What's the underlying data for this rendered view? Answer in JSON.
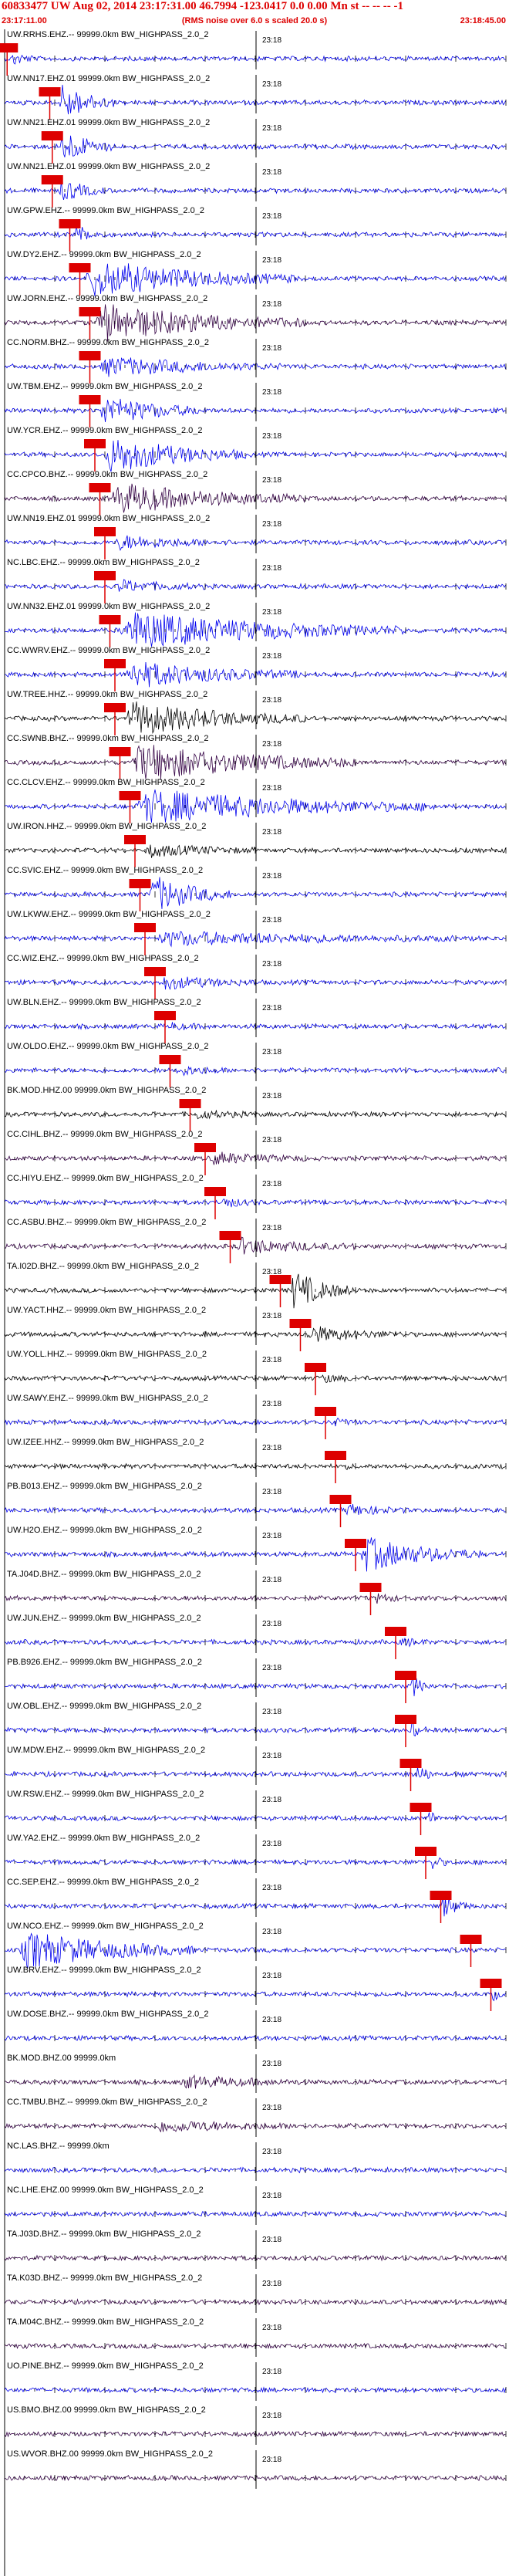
{
  "header": {
    "title": "60833477 UW Aug 02, 2014 23:17:31.00   46.7994 -123.0417  0.0 0.00 Mn st -- -- --  -1",
    "start_time": "23:17:11.00",
    "rms_note": "(RMS noise over 6.0 s scaled 20.0 s)",
    "end_time": "23:18:45.00"
  },
  "tick_label": "23:18",
  "colors": {
    "blue": "#0000ee",
    "purple": "#330044",
    "black": "#000000",
    "red": "#dd0000",
    "grid": "#777777"
  },
  "traces": [
    {
      "label": "UW.RRHS.EHZ.-- 99999.0km BW_HIGHPASS_2.0_2",
      "color": "blue",
      "pick": 0.005,
      "burst": [
        0.015,
        0.06
      ],
      "amp": 0.35
    },
    {
      "label": "UW.NN17.EHZ.01 99999.0km BW_HIGHPASS_2.0_2",
      "color": "blue",
      "pick": 0.09,
      "burst": [
        0.11,
        0.22
      ],
      "amp": 1.0
    },
    {
      "label": "UW.NN21.EHZ.01 99999.0km BW_HIGHPASS_2.0_2",
      "color": "blue",
      "pick": 0.095,
      "burst": [
        0.11,
        0.22
      ],
      "amp": 0.9
    },
    {
      "label": "UW.NN21.EHZ.01 99999.0km BW_HIGHPASS_2.0_2",
      "color": "blue",
      "pick": 0.095,
      "burst": [
        0.11,
        0.2
      ],
      "amp": 0.6
    },
    {
      "label": "UW.GPW.EHZ.-- 99999.0km BW_HIGHPASS_2.0_2",
      "color": "blue",
      "pick": 0.13,
      "burst": [
        0.14,
        0.2
      ],
      "amp": 0.5
    },
    {
      "label": "UW.DY2.EHZ.-- 99999.0km BW_HIGHPASS_2.0_2",
      "color": "blue",
      "pick": 0.15,
      "burst": [
        0.16,
        0.58
      ],
      "amp": 1.0
    },
    {
      "label": "UW.JORN.EHZ.-- 99999.0km BW_HIGHPASS_2.0_2",
      "color": "purple",
      "pick": 0.17,
      "burst": [
        0.18,
        0.6
      ],
      "amp": 1.0
    },
    {
      "label": "CC.NORM.BHZ.-- 99999.0km BW_HIGHPASS_2.0_2",
      "color": "blue",
      "pick": 0.17,
      "burst": [
        0.19,
        0.55
      ],
      "amp": 0.5
    },
    {
      "label": "UW.TBM.EHZ.-- 99999.0km BW_HIGHPASS_2.0_2",
      "color": "blue",
      "pick": 0.17,
      "burst": [
        0.19,
        0.4
      ],
      "amp": 0.8
    },
    {
      "label": "UW.YCR.EHZ.-- 99999.0km BW_HIGHPASS_2.0_2",
      "color": "blue",
      "pick": 0.18,
      "burst": [
        0.2,
        0.48
      ],
      "amp": 1.0
    },
    {
      "label": "CC.CPCO.BHZ.-- 99999.0km BW_HIGHPASS_2.0_2",
      "color": "purple",
      "pick": 0.19,
      "burst": [
        0.21,
        0.6
      ],
      "amp": 0.8
    },
    {
      "label": "UW.NN19.EHZ.01 99999.0km BW_HIGHPASS_2.0_2",
      "color": "blue",
      "pick": 0.2,
      "burst": [
        0.22,
        0.45
      ],
      "amp": 0.35
    },
    {
      "label": "NC.LBC.EHZ.-- 99999.0km BW_HIGHPASS_2.0_2",
      "color": "blue",
      "pick": 0.2,
      "burst": [
        0.22,
        0.4
      ],
      "amp": 0.3
    },
    {
      "label": "UW.NN32.EHZ.01 99999.0km BW_HIGHPASS_2.0_2",
      "color": "blue",
      "pick": 0.21,
      "burst": [
        0.23,
        0.8
      ],
      "amp": 1.0
    },
    {
      "label": "CC.WWRV.EHZ.-- 99999.0km BW_HIGHPASS_2.0_2",
      "color": "blue",
      "pick": 0.22,
      "burst": [
        0.24,
        0.6
      ],
      "amp": 0.7
    },
    {
      "label": "UW.TREE.HHZ.-- 99999.0km BW_HIGHPASS_2.0_2",
      "color": "black",
      "pick": 0.22,
      "burst": [
        0.24,
        0.6
      ],
      "amp": 0.9
    },
    {
      "label": "CC.SWNB.BHZ.-- 99999.0km BW_HIGHPASS_2.0_2",
      "color": "purple",
      "pick": 0.23,
      "burst": [
        0.25,
        0.7
      ],
      "amp": 1.0
    },
    {
      "label": "CC.CLCV.EHZ.-- 99999.0km BW_HIGHPASS_2.0_2",
      "color": "blue",
      "pick": 0.25,
      "burst": [
        0.26,
        0.86
      ],
      "amp": 0.9
    },
    {
      "label": "UW.IRON.HHZ.-- 99999.0km BW_HIGHPASS_2.0_2",
      "color": "black",
      "pick": 0.26,
      "burst": [
        0.28,
        0.5
      ],
      "amp": 0.3
    },
    {
      "label": "CC.SVIC.EHZ.-- 99999.0km BW_HIGHPASS_2.0_2",
      "color": "blue",
      "pick": 0.27,
      "burst": [
        0.29,
        0.45
      ],
      "amp": 1.0
    },
    {
      "label": "UW.LKWW.EHZ.-- 99999.0km BW_HIGHPASS_2.0_2",
      "color": "blue",
      "pick": 0.28,
      "burst": [
        0.3,
        0.9
      ],
      "amp": 0.35
    },
    {
      "label": "CC.WIZ.EHZ.-- 99999.0km BW_HIGHPASS_2.0_2",
      "color": "blue",
      "pick": 0.3,
      "burst": [
        0.31,
        0.5
      ],
      "amp": 0.35
    },
    {
      "label": "UW.BLN.EHZ.-- 99999.0km BW_HIGHPASS_2.0_2",
      "color": "blue",
      "pick": 0.32,
      "burst": [
        0.33,
        0.4
      ],
      "amp": 0.15
    },
    {
      "label": "UW.OLDO.EHZ.-- 99999.0km BW_HIGHPASS_2.0_2",
      "color": "blue",
      "pick": 0.33,
      "burst": [
        0.34,
        0.45
      ],
      "amp": 0.25
    },
    {
      "label": "BK.MOD.HHZ.00 99999.0km BW_HIGHPASS_2.0_2",
      "color": "black",
      "pick": 0.37,
      "burst": [
        0.38,
        0.5
      ],
      "amp": 0.2
    },
    {
      "label": "CC.CIHL.BHZ.-- 99999.0km BW_HIGHPASS_2.0_2",
      "color": "purple",
      "pick": 0.4,
      "burst": [
        0.41,
        0.6
      ],
      "amp": 0.3
    },
    {
      "label": "CC.HIYU.EHZ.-- 99999.0km BW_HIGHPASS_2.0_2",
      "color": "blue",
      "pick": 0.42,
      "burst": [
        0.43,
        0.5
      ],
      "amp": 0.3
    },
    {
      "label": "CC.ASBU.BHZ.-- 99999.0km BW_HIGHPASS_2.0_2",
      "color": "purple",
      "pick": 0.45,
      "burst": [
        0.46,
        0.7
      ],
      "amp": 0.4
    },
    {
      "label": "TA.I02D.BHZ.-- 99999.0km BW_HIGHPASS_2.0_2",
      "color": "black",
      "pick": 0.55,
      "burst": [
        0.57,
        0.7
      ],
      "amp": 1.0
    },
    {
      "label": "UW.YACT.HHZ.-- 99999.0km BW_HIGHPASS_2.0_2",
      "color": "black",
      "pick": 0.59,
      "burst": [
        0.6,
        0.8
      ],
      "amp": 0.4
    },
    {
      "label": "UW.YOLL.HHZ.-- 99999.0km BW_HIGHPASS_2.0_2",
      "color": "black",
      "pick": 0.62,
      "burst": [
        0.63,
        0.7
      ],
      "amp": 0.2
    },
    {
      "label": "UW.SAWY.EHZ.-- 99999.0km BW_HIGHPASS_2.0_2",
      "color": "blue",
      "pick": 0.64,
      "burst": [
        0.65,
        0.7
      ],
      "amp": 0.2
    },
    {
      "label": "UW.IZEE.HHZ.-- 99999.0km BW_HIGHPASS_2.0_2",
      "color": "black",
      "pick": 0.66,
      "burst": [
        0.67,
        0.7
      ],
      "amp": 0.1
    },
    {
      "label": "PB.B013.EHZ.-- 99999.0km BW_HIGHPASS_2.0_2",
      "color": "blue",
      "pick": 0.67,
      "burst": [
        0.68,
        0.8
      ],
      "amp": 0.3
    },
    {
      "label": "UW.H2O.EHZ.-- 99999.0km BW_HIGHPASS_2.0_2",
      "color": "blue",
      "pick": 0.7,
      "burst": [
        0.71,
        0.95
      ],
      "amp": 0.9
    },
    {
      "label": "TA.J04D.BHZ.-- 99999.0km BW_HIGHPASS_2.0_2",
      "color": "purple",
      "pick": 0.73,
      "burst": [
        0.74,
        0.8
      ],
      "amp": 0.2
    },
    {
      "label": "UW.JUN.EHZ.-- 99999.0km BW_HIGHPASS_2.0_2",
      "color": "blue",
      "pick": 0.78,
      "burst": [
        0.79,
        0.85
      ],
      "amp": 0.2
    },
    {
      "label": "PB.B926.EHZ.-- 99999.0km BW_HIGHPASS_2.0_2",
      "color": "blue",
      "pick": 0.8,
      "burst": [
        0.81,
        0.85
      ],
      "amp": 0.6
    },
    {
      "label": "UW.OBL.EHZ.-- 99999.0km BW_HIGHPASS_2.0_2",
      "color": "blue",
      "pick": 0.8,
      "burst": [
        0.81,
        0.84
      ],
      "amp": 0.5
    },
    {
      "label": "UW.MDW.EHZ.-- 99999.0km BW_HIGHPASS_2.0_2",
      "color": "blue",
      "pick": 0.81,
      "burst": [
        0.82,
        0.86
      ],
      "amp": 0.5
    },
    {
      "label": "UW.RSW.EHZ.-- 99999.0km BW_HIGHPASS_2.0_2",
      "color": "blue",
      "pick": 0.83,
      "burst": [
        0.84,
        0.87
      ],
      "amp": 0.5
    },
    {
      "label": "UW.YA2.EHZ.-- 99999.0km BW_HIGHPASS_2.0_2",
      "color": "blue",
      "pick": 0.84,
      "burst": [
        0.85,
        0.88
      ],
      "amp": 0.5
    },
    {
      "label": "CC.SEP.EHZ.-- 99999.0km BW_HIGHPASS_2.0_2",
      "color": "blue",
      "pick": 0.87,
      "burst": [
        0.87,
        0.93
      ],
      "amp": 0.6
    },
    {
      "label": "UW.NCO.EHZ.-- 99999.0km BW_HIGHPASS_2.0_2",
      "color": "blue",
      "pick": 0.93,
      "burst": [
        0.03,
        0.38
      ],
      "amp": 1.0
    },
    {
      "label": "UW.BRV.EHZ.-- 99999.0km BW_HIGHPASS_2.0_2",
      "color": "blue",
      "pick": 0.97,
      "burst": [
        0.97,
        0.99
      ],
      "amp": 0.5
    },
    {
      "label": "UW.DOSE.BHZ.-- 99999.0km BW_HIGHPASS_2.0_2",
      "color": "blue",
      "pick": null,
      "burst": null,
      "amp": 0
    },
    {
      "label": "BK.MOD.BHZ.00 99999.0km",
      "color": "purple",
      "pick": null,
      "burst": [
        0.35,
        0.6
      ],
      "amp": 0.3
    },
    {
      "label": "CC.TMBU.BHZ.-- 99999.0km BW_HIGHPASS_2.0_2",
      "color": "purple",
      "pick": null,
      "burst": [
        0.3,
        0.6
      ],
      "amp": 0.3
    },
    {
      "label": "NC.LAS.BHZ.-- 99999.0km",
      "color": "blue",
      "pick": null,
      "burst": null,
      "amp": 0
    },
    {
      "label": "NC.LHE.EHZ.00 99999.0km BW_HIGHPASS_2.0_2",
      "color": "blue",
      "pick": null,
      "burst": null,
      "amp": 0
    },
    {
      "label": "TA.J03D.BHZ.-- 99999.0km BW_HIGHPASS_2.0_2",
      "color": "purple",
      "pick": null,
      "burst": null,
      "amp": 0
    },
    {
      "label": "TA.K03D.BHZ.-- 99999.0km BW_HIGHPASS_2.0_2",
      "color": "purple",
      "pick": null,
      "burst": null,
      "amp": 0
    },
    {
      "label": "TA.M04C.BHZ.-- 99999.0km BW_HIGHPASS_2.0_2",
      "color": "purple",
      "pick": null,
      "burst": null,
      "amp": 0
    },
    {
      "label": "UO.PINE.BHZ.-- 99999.0km BW_HIGHPASS_2.0_2",
      "color": "blue",
      "pick": null,
      "burst": null,
      "amp": 0
    },
    {
      "label": "US.BMO.BHZ.00 99999.0km BW_HIGHPASS_2.0_2",
      "color": "purple",
      "pick": null,
      "burst": null,
      "amp": 0
    },
    {
      "label": "US.WVOR.BHZ.00 99999.0km BW_HIGHPASS_2.0_2",
      "color": "purple",
      "pick": null,
      "burst": null,
      "amp": 0
    }
  ]
}
